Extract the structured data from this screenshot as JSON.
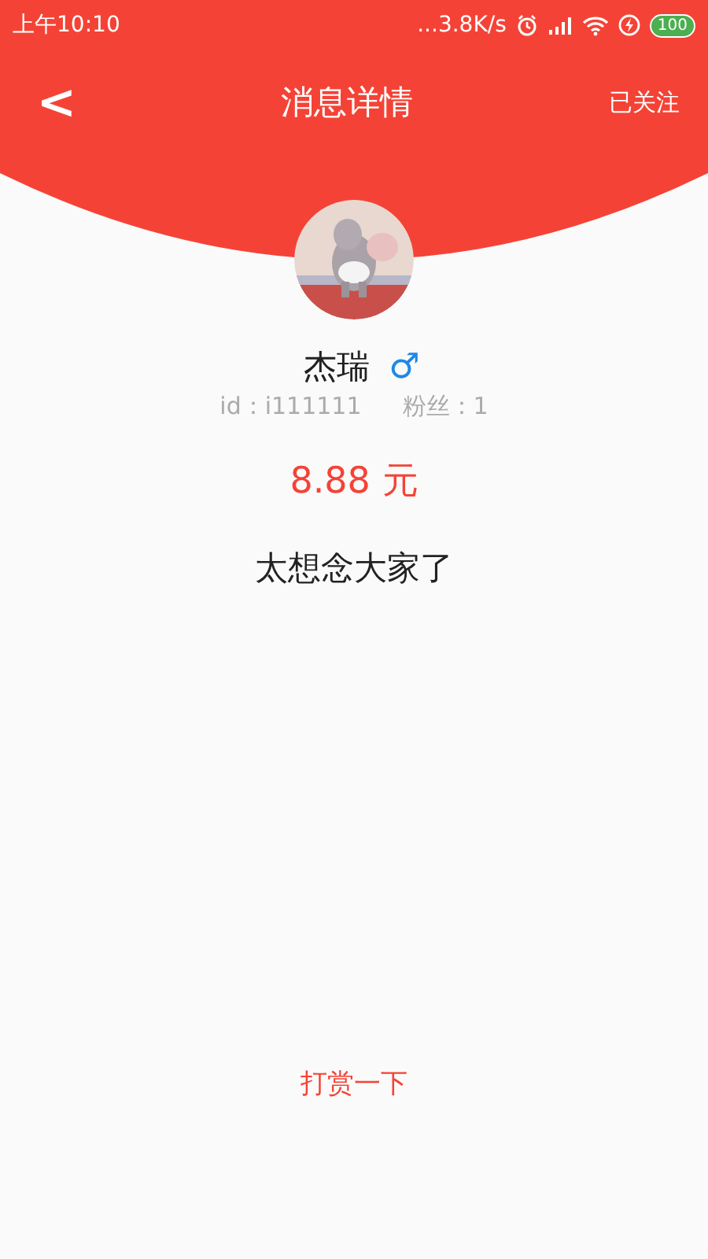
{
  "status_bar": {
    "time": "上午10:10",
    "network_speed": "...3.8K/s",
    "battery": "100"
  },
  "header": {
    "back": "<",
    "title": "消息详情",
    "follow": "已关注"
  },
  "profile": {
    "name": "杰瑞",
    "gender": "♂",
    "id": "id：i111111",
    "fans": "粉丝：1"
  },
  "amount": "8.88 元",
  "message": "太想念大家了",
  "reward_button": "打赏一下"
}
